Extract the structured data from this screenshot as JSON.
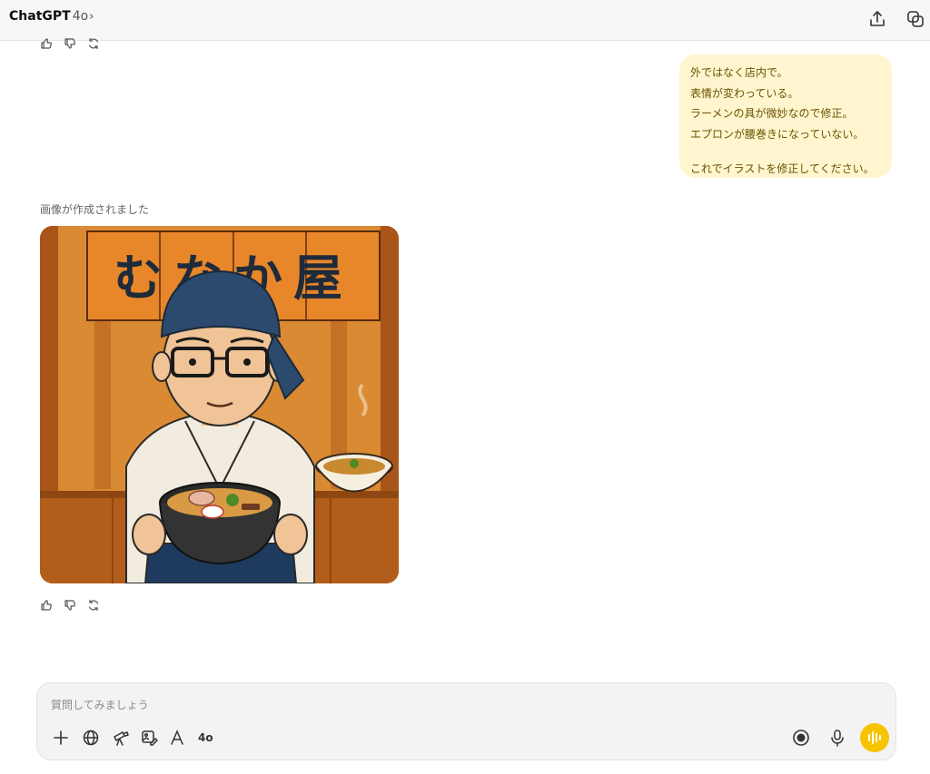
{
  "header": {
    "app_name": "ChatGPT",
    "model": "4o",
    "chevron": "›",
    "icons": [
      "share-icon",
      "new-chat-icon"
    ]
  },
  "conversation": {
    "user_message": {
      "lines": [
        "外ではなく店内で。",
        "表情が変わっている。",
        "ラーメンの具が微妙なので修正。",
        "エプロンが腰巻きになっていない。",
        "これでイラストを修正してください。"
      ]
    },
    "assistant_caption": "画像が作成されました",
    "image": {
      "sign_text": "むなか屋"
    },
    "feedback_icons": [
      "thumbs-up-icon",
      "thumbs-down-icon",
      "regenerate-icon"
    ]
  },
  "composer": {
    "placeholder": "質問してみましょう",
    "tools": [
      "plus-icon",
      "globe-icon",
      "telescope-icon",
      "image-edit-icon",
      "canvas-icon"
    ],
    "model_label": "4o",
    "right_icons": [
      "record-icon",
      "microphone-icon",
      "voice-mode-icon"
    ],
    "accent_color": "#f7c400"
  }
}
